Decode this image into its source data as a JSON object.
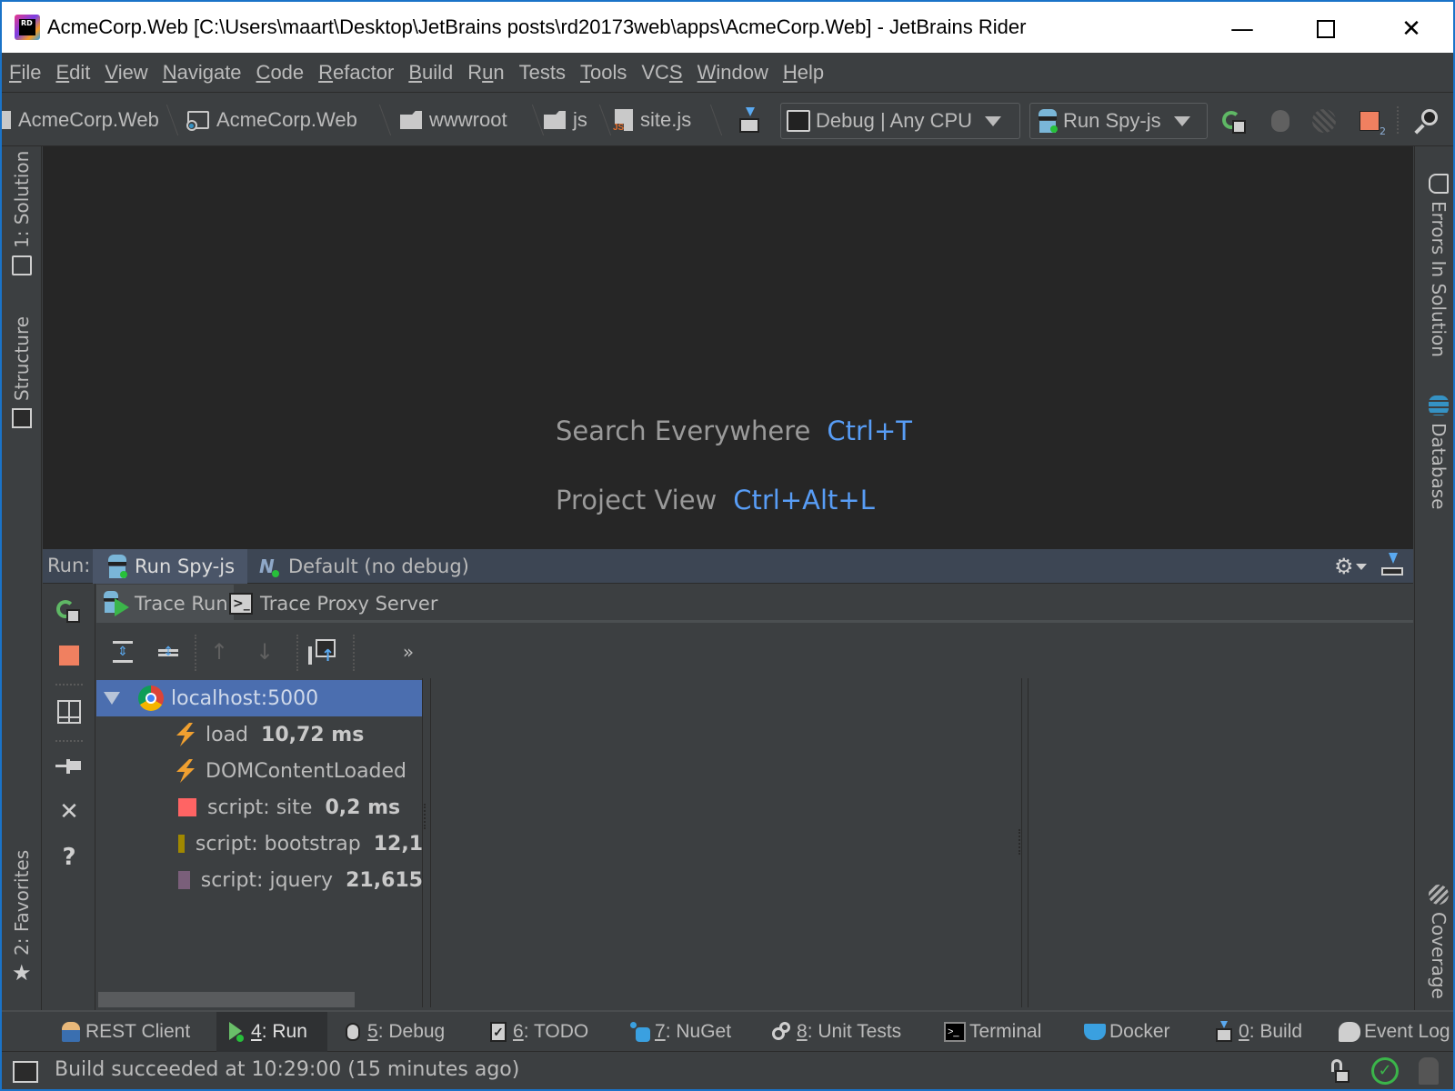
{
  "window": {
    "title": "AcmeCorp.Web [C:\\Users\\maart\\Desktop\\JetBrains posts\\rd20173web\\apps\\AcmeCorp.Web] - JetBrains Rider",
    "logo_text": "RD",
    "minimize_icon": "minimize-icon",
    "maximize_icon": "maximize-icon",
    "close_icon": "close-icon"
  },
  "menu": {
    "items": [
      {
        "label": "File",
        "mnemonic": "F"
      },
      {
        "label": "Edit",
        "mnemonic": "E"
      },
      {
        "label": "View",
        "mnemonic": "V"
      },
      {
        "label": "Navigate",
        "mnemonic": "N"
      },
      {
        "label": "Code",
        "mnemonic": "C"
      },
      {
        "label": "Refactor",
        "mnemonic": "R"
      },
      {
        "label": "Build",
        "mnemonic": "B"
      },
      {
        "label": "Run",
        "mnemonic": "u"
      },
      {
        "label": "Tests",
        "mnemonic": ""
      },
      {
        "label": "Tools",
        "mnemonic": "T"
      },
      {
        "label": "VCS",
        "mnemonic": "S"
      },
      {
        "label": "Window",
        "mnemonic": "W"
      },
      {
        "label": "Help",
        "mnemonic": "H"
      }
    ]
  },
  "navbar": {
    "breadcrumbs": [
      {
        "label": "AcmeCorp.Web",
        "icon": "solution-icon"
      },
      {
        "label": "AcmeCorp.Web",
        "icon": "project-icon"
      },
      {
        "label": "wwwroot",
        "icon": "folder-icon"
      },
      {
        "label": "js",
        "icon": "folder-icon"
      },
      {
        "label": "site.js",
        "icon": "js-file-icon"
      }
    ],
    "build_config": "Debug | Any CPU",
    "run_config": "Run Spy-js",
    "stop_badge": "2"
  },
  "left_strip": {
    "solution": {
      "label": "1: Solution"
    },
    "structure": {
      "label": "Structure"
    },
    "favorites": {
      "label": "2: Favorites"
    }
  },
  "right_strip": {
    "errors": {
      "label": "Errors In Solution"
    },
    "database": {
      "label": "Database"
    },
    "coverage": {
      "label": "Coverage"
    }
  },
  "editor": {
    "hints": [
      {
        "label": "Search Everywhere",
        "shortcut": "Ctrl+T"
      },
      {
        "label": "Project View",
        "shortcut": "Ctrl+Alt+L"
      }
    ]
  },
  "run_window": {
    "label": "Run:",
    "tabs": [
      {
        "label": "Run Spy-js",
        "active": true
      },
      {
        "label": "Default (no debug)",
        "active": false
      }
    ],
    "subtabs": [
      {
        "label": "Trace Run",
        "active": true
      },
      {
        "label": "Trace Proxy Server",
        "active": false
      }
    ],
    "tree": {
      "root": "localhost:5000",
      "items": [
        {
          "label": "load",
          "value": "10,72 ms",
          "kind": "event",
          "color": "#f0a030"
        },
        {
          "label": "DOMContentLoaded",
          "value": "",
          "kind": "event",
          "color": "#f0a030"
        },
        {
          "label": "script: site",
          "value": "0,2 ms",
          "kind": "script",
          "color": "#ff6464"
        },
        {
          "label": "script: bootstrap",
          "value": "12,1",
          "kind": "script",
          "color": "#a08800"
        },
        {
          "label": "script: jquery",
          "value": "21,615",
          "kind": "script",
          "color": "#7a5f7a"
        }
      ]
    }
  },
  "bottom_tabs": [
    {
      "label": "REST Client",
      "mnemonic": "",
      "active": false
    },
    {
      "label": ": Run",
      "mnemonic": "4",
      "active": true
    },
    {
      "label": ": Debug",
      "mnemonic": "5",
      "active": false
    },
    {
      "label": ": TODO",
      "mnemonic": "6",
      "active": false
    },
    {
      "label": ": NuGet",
      "mnemonic": "7",
      "active": false
    },
    {
      "label": ": Unit Tests",
      "mnemonic": "8",
      "active": false
    },
    {
      "label": "Terminal",
      "mnemonic": "",
      "active": false
    },
    {
      "label": "Docker",
      "mnemonic": "",
      "active": false
    },
    {
      "label": ": Build",
      "mnemonic": "0",
      "active": false
    },
    {
      "label": "Event Log",
      "mnemonic": "",
      "active": false
    }
  ],
  "status": {
    "message": "Build succeeded at 10:29:00 (15 minutes ago)"
  },
  "colors": {
    "accent": "#589df6",
    "selection": "#4b6eaf",
    "stop": "#f08060",
    "run_green": "#5fb865"
  }
}
